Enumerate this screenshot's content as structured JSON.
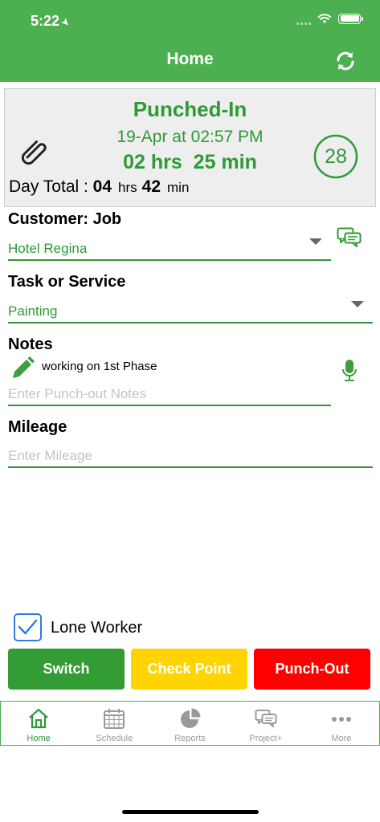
{
  "status_bar": {
    "time": "5:22",
    "location_icon": "location-arrow-icon",
    "wifi_icon": "wifi-icon",
    "battery_icon": "battery-icon"
  },
  "header": {
    "title": "Home",
    "refresh_icon": "refresh-icon"
  },
  "punch_card": {
    "status": "Punched-In",
    "date_time": "19-Apr at 02:57 PM",
    "duration": "02 hrs  25 min",
    "attachment_icon": "paperclip-icon",
    "count": "28",
    "day_total_label": "Day Total :",
    "day_total_hours": "04",
    "hours_unit": "hrs",
    "day_total_minutes": "42",
    "minutes_unit": "min"
  },
  "customer_job": {
    "label": "Customer: Job",
    "value": "Hotel Regina",
    "chat_icon": "chat-bubbles-icon"
  },
  "task": {
    "label": "Task or Service",
    "value": "Painting"
  },
  "notes": {
    "label": "Notes",
    "existing_note": "working on 1st Phase",
    "placeholder": "Enter Punch-out Notes",
    "edit_icon": "pencil-icon",
    "mic_icon": "microphone-icon"
  },
  "mileage": {
    "label": "Mileage",
    "placeholder": "Enter Mileage"
  },
  "lone_worker": {
    "label": "Lone Worker",
    "checked": true
  },
  "actions": {
    "switch": "Switch",
    "check_point": "Check Point",
    "punch_out": "Punch-Out"
  },
  "tabs": [
    {
      "label": "Home",
      "icon": "home-icon",
      "active": true
    },
    {
      "label": "Schedule",
      "icon": "calendar-icon",
      "active": false
    },
    {
      "label": "Reports",
      "icon": "pie-chart-icon",
      "active": false
    },
    {
      "label": "Project+",
      "icon": "chat-bubbles-icon",
      "active": false
    },
    {
      "label": "More",
      "icon": "more-dots-icon",
      "active": false
    }
  ],
  "colors": {
    "primary": "#4caf50",
    "text_green": "#2e9a36",
    "switch": "#349c34",
    "check_point": "#ffd400",
    "punch_out": "#ff0000",
    "checkbox": "#2f7de1"
  }
}
